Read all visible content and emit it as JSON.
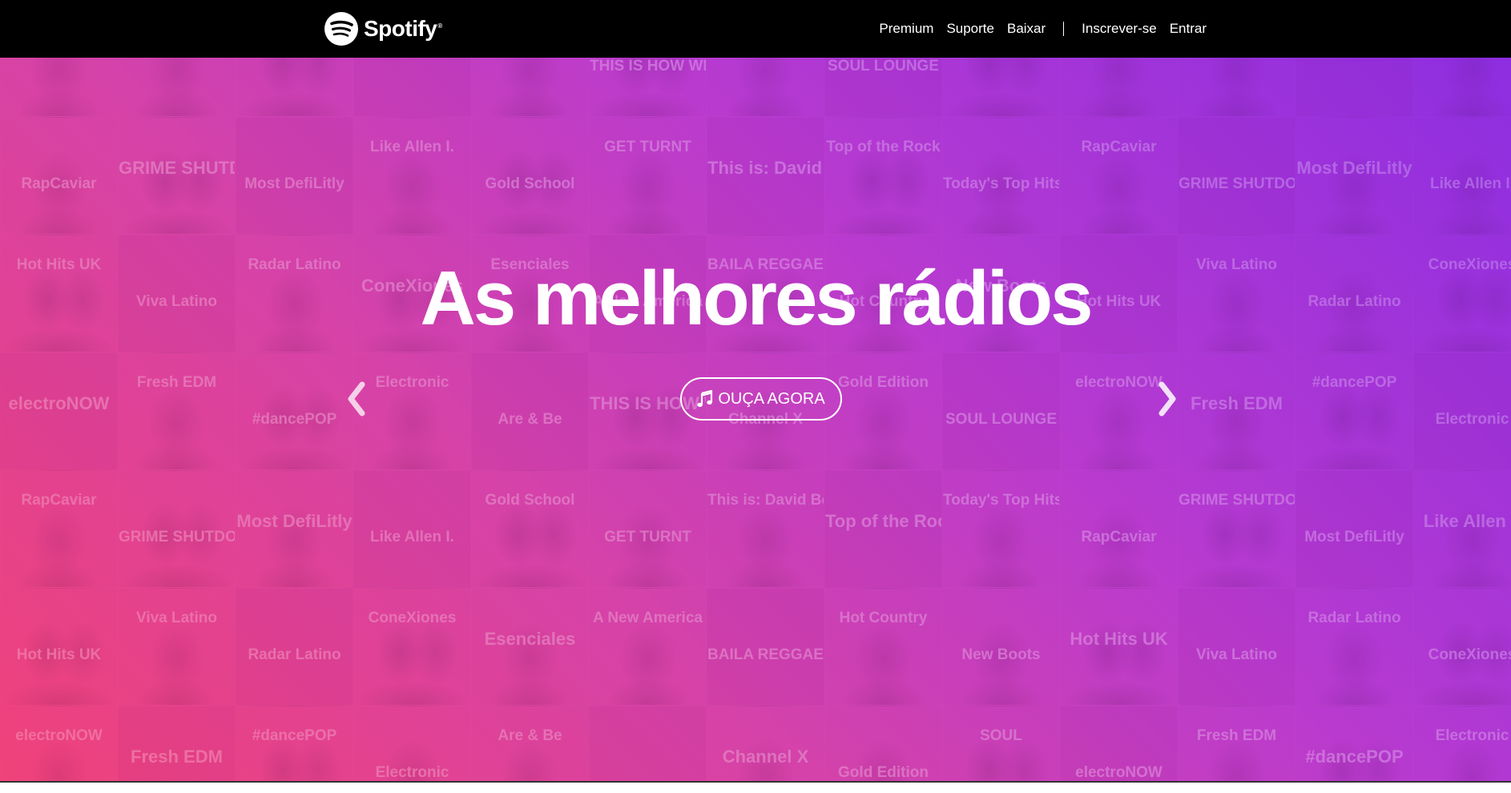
{
  "brand": {
    "name": "Spotify",
    "registered": "®",
    "logo_icon": "spotify-logo-icon"
  },
  "nav": {
    "premium": "Premium",
    "support": "Suporte",
    "download": "Baixar",
    "signup": "Inscrever-se",
    "login": "Entrar"
  },
  "hero": {
    "headline": "As melhores rádios",
    "cta_label": "OUÇA AGORA",
    "cta_icon": "music-note-icon",
    "prev_icon": "chevron-left-icon",
    "next_icon": "chevron-right-icon",
    "playlist_tiles": [
      "",
      "",
      "",
      "",
      "",
      "THIS IS HOW WE DO",
      "",
      "SOUL LOUNGE",
      "",
      "",
      "",
      "",
      "",
      "RapCaviar",
      "GRIME SHUTDOWN",
      "Most DefiLitly",
      "Like Allen I.",
      "Gold School",
      "GET TURNT",
      "This is: David Bowie",
      "Top of the Rock",
      "Today's Top Hits",
      "RapCaviar",
      "GRIME SHUTDOWN",
      "Most DefiLitly",
      "Like Allen I.",
      "Hot Hits UK",
      "Viva Latino",
      "Radar Latino",
      "ConeXiones",
      "Esenciales",
      "A New America",
      "BAILA REGGAETON",
      "Hot Country",
      "New Boots",
      "Hot Hits UK",
      "Viva Latino",
      "Radar Latino",
      "ConeXiones",
      "electroNOW",
      "Fresh EDM",
      "#dancePOP",
      "Electronic",
      "Are & Be",
      "THIS IS HOW WE DO",
      "Channel X",
      "Gold Edition",
      "SOUL LOUNGE",
      "electroNOW",
      "Fresh EDM",
      "#dancePOP",
      "Electronic",
      "RapCaviar",
      "GRIME SHUTDOWN",
      "Most DefiLitly",
      "Like Allen I.",
      "Gold School",
      "GET TURNT",
      "This is: David Bowie",
      "Top of the Rock",
      "Today's Top Hits",
      "RapCaviar",
      "GRIME SHUTDOWN",
      "Most DefiLitly",
      "Like Allen I.",
      "Hot Hits UK",
      "Viva Latino",
      "Radar Latino",
      "ConeXiones",
      "Esenciales",
      "A New America",
      "BAILA REGGAETON",
      "Hot Country",
      "New Boots",
      "Hot Hits UK",
      "Viva Latino",
      "Radar Latino",
      "ConeXiones",
      "electroNOW",
      "Fresh EDM",
      "#dancePOP",
      "Electronic",
      "Are & Be",
      "",
      "Channel X",
      "Gold Edition",
      "SOUL",
      "electroNOW",
      "Fresh EDM",
      "#dancePOP",
      "Electronic"
    ]
  },
  "colors": {
    "topbar": "#000000",
    "gradient_start": "#f0427a",
    "gradient_end": "#8f2fe0",
    "text": "#ffffff"
  }
}
